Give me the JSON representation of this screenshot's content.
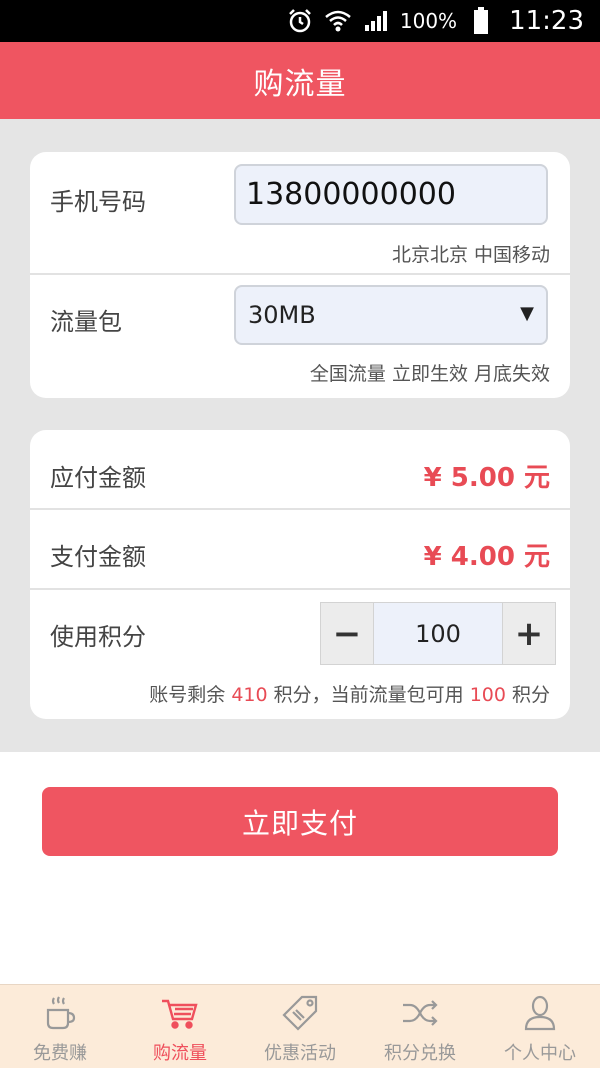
{
  "status_bar": {
    "battery_text": "100%",
    "time": "11:23",
    "icons": [
      "alarm-icon",
      "wifi-icon",
      "signal-icon",
      "battery-icon"
    ]
  },
  "header": {
    "title": "购流量"
  },
  "card1": {
    "phone_label": "手机号码",
    "phone_value": "13800000000",
    "location_text": "北京北京  中国移动",
    "package_label": "流量包",
    "package_selected": "30MB",
    "package_desc": "全国流量 立即生效 月底失效"
  },
  "card2": {
    "payable_label": "应付金额",
    "payable_value": "¥ 5.00 元",
    "pay_label": "支付金额",
    "pay_value": "¥ 4.00 元",
    "points_label": "使用积分",
    "points_value": "100",
    "minus": "−",
    "plus": "+",
    "note_prefix": "账号剩余 ",
    "remaining_points": "410",
    "note_mid": " 积分，当前流量包可用 ",
    "usable_points": "100",
    "note_suffix": " 积分"
  },
  "pay_button": {
    "label": "立即支付"
  },
  "bottom_nav": {
    "items": [
      {
        "label": "免费赚",
        "icon": "coffee-cup-icon",
        "active": false
      },
      {
        "label": "购流量",
        "icon": "shopping-cart-icon",
        "active": true
      },
      {
        "label": "优惠活动",
        "icon": "discount-tag-icon",
        "active": false
      },
      {
        "label": "积分兑换",
        "icon": "shuffle-icon",
        "active": false
      },
      {
        "label": "个人中心",
        "icon": "user-icon",
        "active": false
      }
    ]
  },
  "colors": {
    "brand": "#ef5561",
    "price": "#e84b55",
    "nav_bg": "#fcebd9"
  }
}
